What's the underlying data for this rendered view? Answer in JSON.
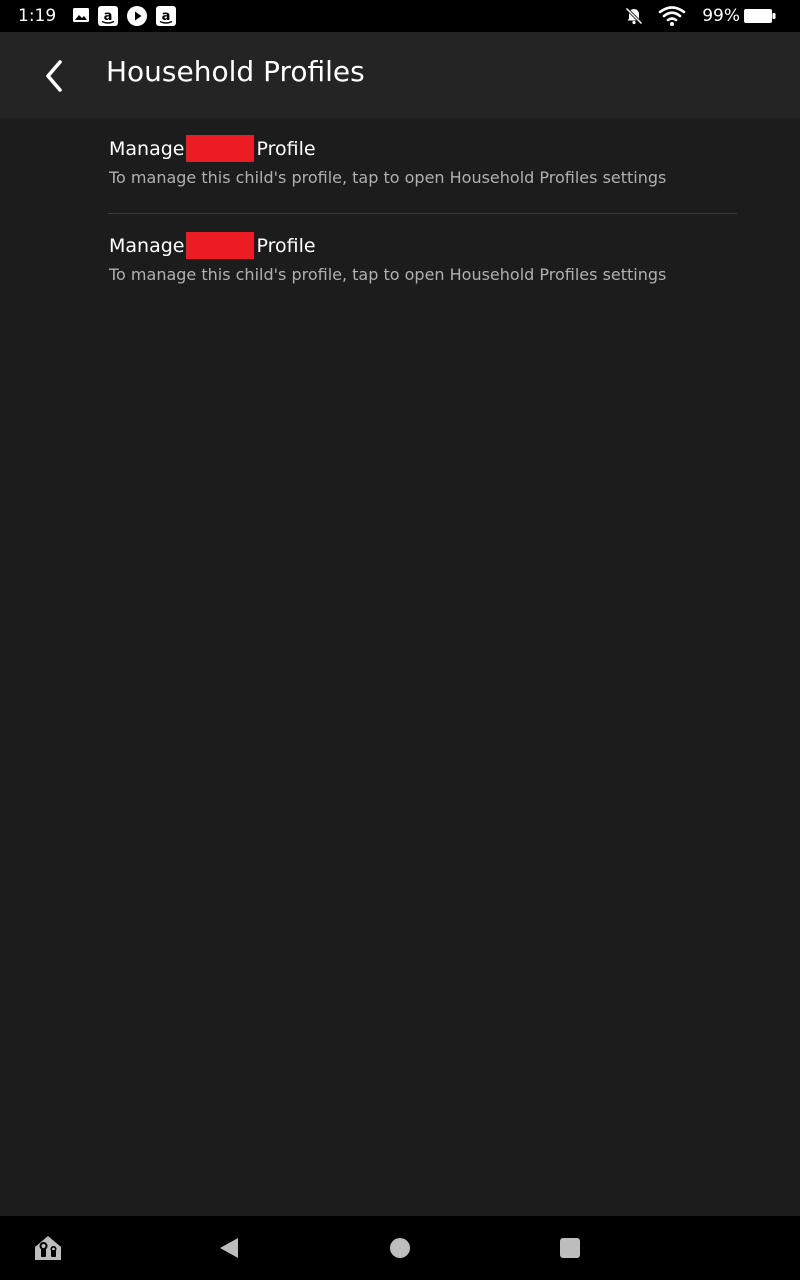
{
  "status_bar": {
    "time": "1:19",
    "battery": "99%",
    "left_icons": [
      "image-icon",
      "amazon-icon",
      "play-icon",
      "amazon-icon"
    ],
    "right_icons": [
      "bell-muted-icon",
      "wifi-icon",
      "battery-icon"
    ]
  },
  "app_bar": {
    "title": "Household Profiles"
  },
  "profiles": [
    {
      "title_prefix": "Manage",
      "title_suffix": "Profile",
      "subtitle": "To manage this child's profile, tap to open Household Profiles settings"
    },
    {
      "title_prefix": "Manage",
      "title_suffix": "Profile",
      "subtitle": "To manage this child's profile, tap to open Household Profiles settings"
    }
  ],
  "colors": {
    "background": "#1c1c1c",
    "app_bar": "#242424",
    "status_bar": "#000000",
    "redaction": "#ec1c24",
    "subtitle": "#b0b0b0"
  }
}
